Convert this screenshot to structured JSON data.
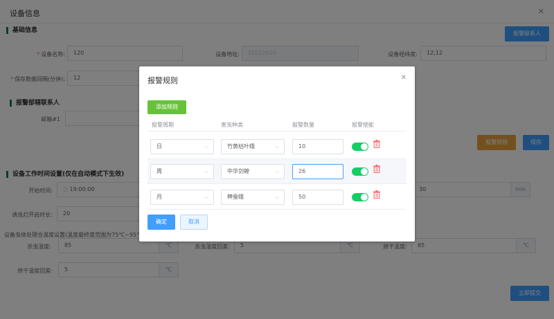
{
  "dialog": {
    "title": "设备信息",
    "close_icon": "close-icon"
  },
  "basic": {
    "section_title": "基础信息",
    "alarm_contact_button": "报警联系人",
    "device_name_label": "设备名称:",
    "device_name_value": "120",
    "device_address_label": "设备地址:",
    "device_address_value": "21022610",
    "device_latlng_label": "设备经纬度:",
    "device_latlng_value": "12,12",
    "save_interval_label": "保存数据间隔(分钟):",
    "save_interval_value": "12"
  },
  "contacts": {
    "section_title": "报警部辖联系人",
    "email_label": "邮箱#1",
    "alarm_rule_button": "报警规则",
    "save_button": "保存"
  },
  "worktime": {
    "section_title": "设备工作时间设置(仅在自动模式下生效)",
    "start_time_label": "开始时间:",
    "start_time_value": "19:00:00",
    "right_value": "30",
    "right_unit": "min",
    "lure_light_label": "诱虫灯开启时长:",
    "lure_light_value": "20",
    "temp_note": "设备虫体处理仓温度设置(温度最终度范围为75℃~95℃",
    "kill_temp_label": "杀虫温度:",
    "kill_temp_value": "85",
    "kill_diff_label": "杀虫温度回差:",
    "kill_diff_value": "5",
    "dry_temp_label": "烘干温度:",
    "dry_temp_value": "85",
    "dry_diff_label": "烘干温度回差:",
    "dry_diff_value": "5",
    "unit": "℃",
    "submit_button": "立即提交"
  },
  "modal": {
    "title": "报警规则",
    "add_button": "添加规则",
    "headers": [
      "报警周期",
      "害虫种类",
      "报警数量",
      "报警使能"
    ],
    "rows": [
      {
        "period": "日",
        "pest": "竹黄枯叶蛾",
        "count": "10",
        "enabled": true
      },
      {
        "period": "周",
        "pest": "中华剑蝗",
        "count": "26",
        "enabled": true
      },
      {
        "period": "月",
        "pest": "稗蚕蛾",
        "count": "50",
        "enabled": true
      }
    ],
    "ok_button": "确定",
    "cancel_button": "取消"
  },
  "colors": {
    "primary": "#409eff",
    "success": "#67c23a",
    "warning": "#e6a23c",
    "switch_on": "#13ce66",
    "danger": "#f56c6c"
  }
}
